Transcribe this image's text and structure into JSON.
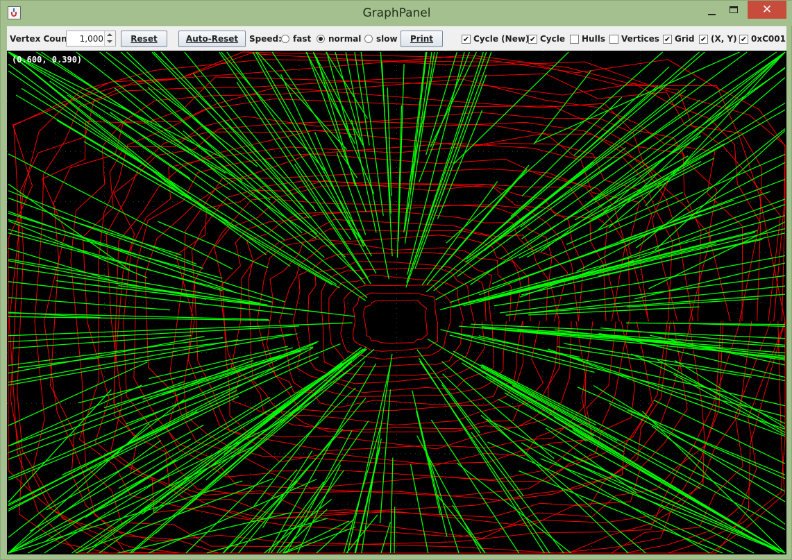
{
  "window": {
    "title": "GraphPanel",
    "close_glyph": "✕"
  },
  "toolbar": {
    "vertex_count_label": "Vertex Count:",
    "vertex_count_value": "1,000",
    "reset_label": "Reset",
    "auto_reset_label": "Auto-Reset",
    "speed_label": "Speed:",
    "speed_options": [
      {
        "label": "fast",
        "selected": false
      },
      {
        "label": "normal",
        "selected": true
      },
      {
        "label": "slow",
        "selected": false
      }
    ],
    "print_label": "Print",
    "checkboxes": [
      {
        "label": "Cycle (New)",
        "checked": true
      },
      {
        "label": "Cycle",
        "checked": true
      },
      {
        "label": "Hulls",
        "checked": false
      },
      {
        "label": "Vertices",
        "checked": false
      },
      {
        "label": "Grid",
        "checked": true
      },
      {
        "label": "(X, Y)",
        "checked": true
      },
      {
        "label": "0xC001",
        "checked": true
      }
    ]
  },
  "canvas": {
    "coordinate_readout": "(0.600, 0.390)",
    "background_color": "#000000",
    "cycle_new_color": "#00ff00",
    "cycle_color": "#ff0000",
    "grid_color": "#3a3a3a"
  }
}
